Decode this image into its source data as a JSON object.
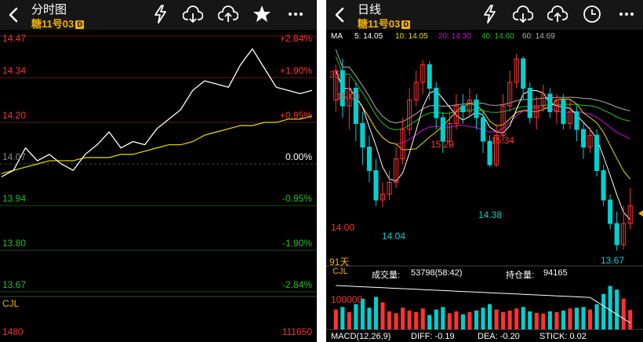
{
  "left": {
    "title": "分时图",
    "subtitle": "糖11号03",
    "badge": "D",
    "price_labels": [
      "14.47",
      "14.34",
      "14.20",
      "14.07",
      "13.94",
      "13.80",
      "13.67"
    ],
    "pct_labels": [
      "+2.84%",
      "+1.90%",
      "+0.95%",
      "0.00%",
      "-0.95%",
      "-1.90%",
      "-2.84%"
    ],
    "cjl_label": "CJL",
    "vol_left": "1480",
    "vol_right": "111650",
    "icons": [
      "flash-icon",
      "cloud-download-icon",
      "cloud-upload-icon",
      "star-icon",
      "more-icon"
    ]
  },
  "right": {
    "title": "日线",
    "subtitle": "糖11号03",
    "badge": "D",
    "ma": {
      "label": "MA",
      "ma5": "5: 14.05",
      "ma10": "10: 14.05",
      "ma20": "20: 14.30",
      "ma40": "40: 14.60",
      "ma60": "60: 14.69"
    },
    "annotations": {
      "a35": "35",
      "a15_00": "15.00",
      "a15_29": "15.29",
      "a15_34": "15.34",
      "a14_38": "14.38",
      "a14_04": "14.04",
      "a13_67": "13.67",
      "a14_00": "14.00"
    },
    "days_label": "91天",
    "cjl_label": "CJL",
    "volume_label": "成交量:",
    "volume_value": "53798(58:42)",
    "oi_label": "持仓量:",
    "oi_value": "94165",
    "vol_tick": "100000",
    "macd": {
      "label": "MACD(12,26,9)",
      "diff": "DIFF: -0.19",
      "dea": "DEA: -0.20",
      "stick": "STICK: 0.02"
    },
    "icons": [
      "flash-icon",
      "cloud-download-icon",
      "cloud-upload-icon",
      "clock-icon",
      "more-icon"
    ]
  },
  "colors": {
    "up": "#ff3232",
    "down": "#00d0d0",
    "ma5": "#ffffff",
    "ma10": "#e8e000",
    "ma20": "#e000e0",
    "ma40": "#20c020",
    "ma60": "#b0b0b0",
    "yellow": "#f0b000"
  },
  "chart_data": [
    {
      "type": "line",
      "title": "分时图",
      "ylim": [
        13.67,
        14.47
      ],
      "y_ticks": [
        14.47,
        14.34,
        14.2,
        14.07,
        13.94,
        13.8,
        13.67
      ],
      "reference": 14.07,
      "series": [
        {
          "name": "price",
          "values": [
            14.03,
            14.05,
            14.12,
            14.08,
            14.1,
            14.07,
            14.05,
            14.1,
            14.13,
            14.17,
            14.12,
            14.14,
            14.13,
            14.18,
            14.21,
            14.24,
            14.3,
            14.33,
            14.32,
            14.31,
            14.38,
            14.43,
            14.37,
            14.31,
            14.3,
            14.29,
            14.3
          ]
        },
        {
          "name": "avg",
          "values": [
            14.04,
            14.05,
            14.06,
            14.07,
            14.08,
            14.08,
            14.08,
            14.09,
            14.09,
            14.09,
            14.1,
            14.1,
            14.11,
            14.12,
            14.13,
            14.13,
            14.14,
            14.16,
            14.17,
            14.18,
            14.19,
            14.19,
            14.2,
            14.2,
            14.21,
            14.21,
            14.22
          ]
        }
      ]
    },
    {
      "type": "candlestick",
      "title": "日线",
      "ylim": [
        13.6,
        15.4
      ],
      "annotations": [
        15.29,
        15.34,
        14.38,
        14.04,
        13.67,
        14.0
      ],
      "candles": [
        [
          14.95,
          15.2,
          15.25,
          14.85
        ],
        [
          15.2,
          14.9,
          15.3,
          14.8
        ],
        [
          14.9,
          15.05,
          15.15,
          14.7
        ],
        [
          15.05,
          14.75,
          15.1,
          14.6
        ],
        [
          14.75,
          14.55,
          14.85,
          14.4
        ],
        [
          14.55,
          14.35,
          14.65,
          14.25
        ],
        [
          14.35,
          14.1,
          14.45,
          14.05
        ],
        [
          14.1,
          14.15,
          14.25,
          14.04
        ],
        [
          14.15,
          14.25,
          14.35,
          14.1
        ],
        [
          14.25,
          14.45,
          14.55,
          14.2
        ],
        [
          14.45,
          14.7,
          14.8,
          14.4
        ],
        [
          14.7,
          14.95,
          15.05,
          14.65
        ],
        [
          14.95,
          15.1,
          15.2,
          14.9
        ],
        [
          15.1,
          15.25,
          15.29,
          15.0
        ],
        [
          15.25,
          15.05,
          15.28,
          14.95
        ],
        [
          15.05,
          14.8,
          15.1,
          14.7
        ],
        [
          14.8,
          14.6,
          14.85,
          14.5
        ],
        [
          14.6,
          14.75,
          14.85,
          14.55
        ],
        [
          14.75,
          14.9,
          15.0,
          14.7
        ],
        [
          14.9,
          14.85,
          15.0,
          14.75
        ],
        [
          14.85,
          14.95,
          15.05,
          14.8
        ],
        [
          14.95,
          14.8,
          15.0,
          14.7
        ],
        [
          14.8,
          14.6,
          14.85,
          14.5
        ],
        [
          14.6,
          14.4,
          14.65,
          14.38
        ],
        [
          14.4,
          14.65,
          14.75,
          14.38
        ],
        [
          14.65,
          14.9,
          15.0,
          14.6
        ],
        [
          14.9,
          15.1,
          15.2,
          14.85
        ],
        [
          15.1,
          15.3,
          15.34,
          15.05
        ],
        [
          15.3,
          15.05,
          15.32,
          14.95
        ],
        [
          15.05,
          14.8,
          15.1,
          14.75
        ],
        [
          14.8,
          14.9,
          14.98,
          14.7
        ],
        [
          14.9,
          15.0,
          15.08,
          14.85
        ],
        [
          15.0,
          14.85,
          15.05,
          14.8
        ],
        [
          14.85,
          14.95,
          15.0,
          14.75
        ],
        [
          14.95,
          14.75,
          15.0,
          14.7
        ],
        [
          14.75,
          14.85,
          14.95,
          14.7
        ],
        [
          14.85,
          14.7,
          14.9,
          14.6
        ],
        [
          14.7,
          14.55,
          14.75,
          14.45
        ],
        [
          14.55,
          14.65,
          14.72,
          14.5
        ],
        [
          14.65,
          14.35,
          14.7,
          14.3
        ],
        [
          14.35,
          14.1,
          14.4,
          14.05
        ],
        [
          14.1,
          13.9,
          14.15,
          13.85
        ],
        [
          13.9,
          13.72,
          14.0,
          13.67
        ],
        [
          13.72,
          13.9,
          14.05,
          13.68
        ],
        [
          13.9,
          14.05,
          14.2,
          13.85
        ]
      ],
      "volume": [
        55000,
        62000,
        48000,
        70000,
        85000,
        60000,
        90000,
        75000,
        50000,
        45000,
        60000,
        52000,
        48000,
        58000,
        40000,
        55000,
        62000,
        45000,
        50000,
        42000,
        48000,
        52000,
        60000,
        70000,
        55000,
        48000,
        52000,
        58000,
        62000,
        50000,
        46000,
        44000,
        50000,
        48000,
        52000,
        58000,
        60000,
        62000,
        55000,
        70000,
        98000,
        120000,
        110000,
        85000,
        53798
      ]
    }
  ]
}
